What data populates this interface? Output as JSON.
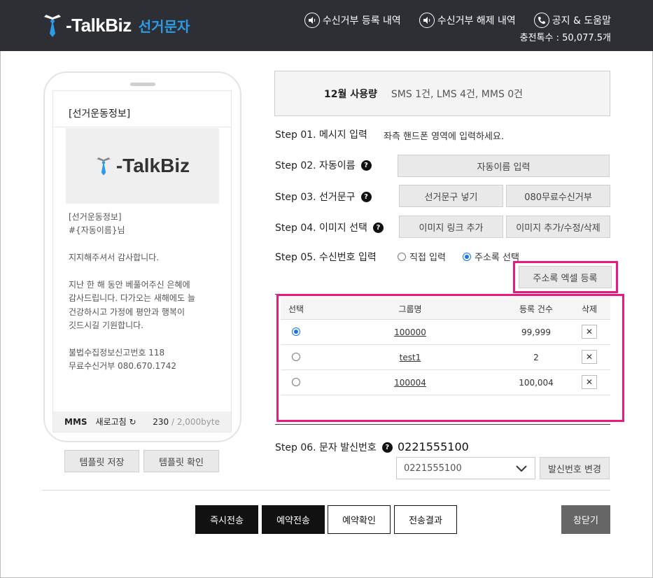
{
  "header": {
    "brand": "-TalkBiz",
    "brand_sub": "선거문자",
    "nav": [
      {
        "label": "수신거부 등록 내역",
        "icon": "speaker-icon"
      },
      {
        "label": "수신거부 해제 내역",
        "icon": "speaker-icon"
      },
      {
        "label": "공지 & 도움말",
        "icon": "phone-icon"
      }
    ],
    "balance": "충전톡수 : 50,077.5개"
  },
  "phone": {
    "title": "[선거운동정보]",
    "image_text": "-TalkBiz",
    "body": "[선거운동정보]\n#{자동이름}님\n\n지지해주셔서 감사합니다.\n\n지난 한 해 동안 베풀어주신 은혜에\n감사드립니다. 다가오는 새해에도 늘\n건강하시고 가정에 평안과 행복이\n깃드시길 기원합니다.\n\n불법수집정보신고번호 118\n무료수신거부 080.670.1742",
    "type": "MMS",
    "refresh": "새로고침",
    "bytes_used": "230",
    "bytes_max": " / 2,000byte"
  },
  "template_buttons": {
    "save": "템플릿 저장",
    "check": "템플릿 확인"
  },
  "usage": {
    "label": "12월 사용량",
    "value": "SMS 1건,  LMS 4건,  MMS 0건"
  },
  "steps": {
    "s1": "Step 01. 메시지 입력",
    "s1_desc": "좌측 핸드폰 영역에 입력하세요.",
    "s2": "Step 02. 자동이름",
    "s2_btn": "자동이름 입력",
    "s3": "Step 03. 선거문구",
    "s3_btn1": "선거문구 넣기",
    "s3_btn2": "080무료수신거부",
    "s4": "Step 04. 이미지 선택",
    "s4_btn1": "이미지 링크 추가",
    "s4_btn2": "이미지 추가/수정/삭제",
    "s5": "Step 05. 수신번호 입력",
    "s5_opt1": "직접 입력",
    "s5_opt2": "주소록 선택",
    "s5_btn": "주소록 엑셀 등록",
    "s6": "Step 06. 문자 발신번호",
    "qmark": "?"
  },
  "table": {
    "headers": {
      "select": "선택",
      "group": "그룹명",
      "count": "등록 건수",
      "delete": "삭제"
    },
    "rows": [
      {
        "group": "100000",
        "count": "99,999",
        "selected": true
      },
      {
        "group": "test1",
        "count": "2",
        "selected": false
      },
      {
        "group": "100004",
        "count": "100,004",
        "selected": false
      }
    ],
    "delete_symbol": "✕"
  },
  "sender": {
    "number": "0221555100",
    "selected_value": "0221555100",
    "change_btn": "발신번호 변경"
  },
  "actions": {
    "send_now": "즉시전송",
    "reserve": "예약전송",
    "reserve_check": "예약확인",
    "result": "전송결과",
    "close": "창닫기"
  },
  "colors": {
    "header_bg": "#2d2f34",
    "brand_blue": "#2b9be8",
    "highlight": "#e8197f",
    "radio_blue": "#1a73e8"
  }
}
